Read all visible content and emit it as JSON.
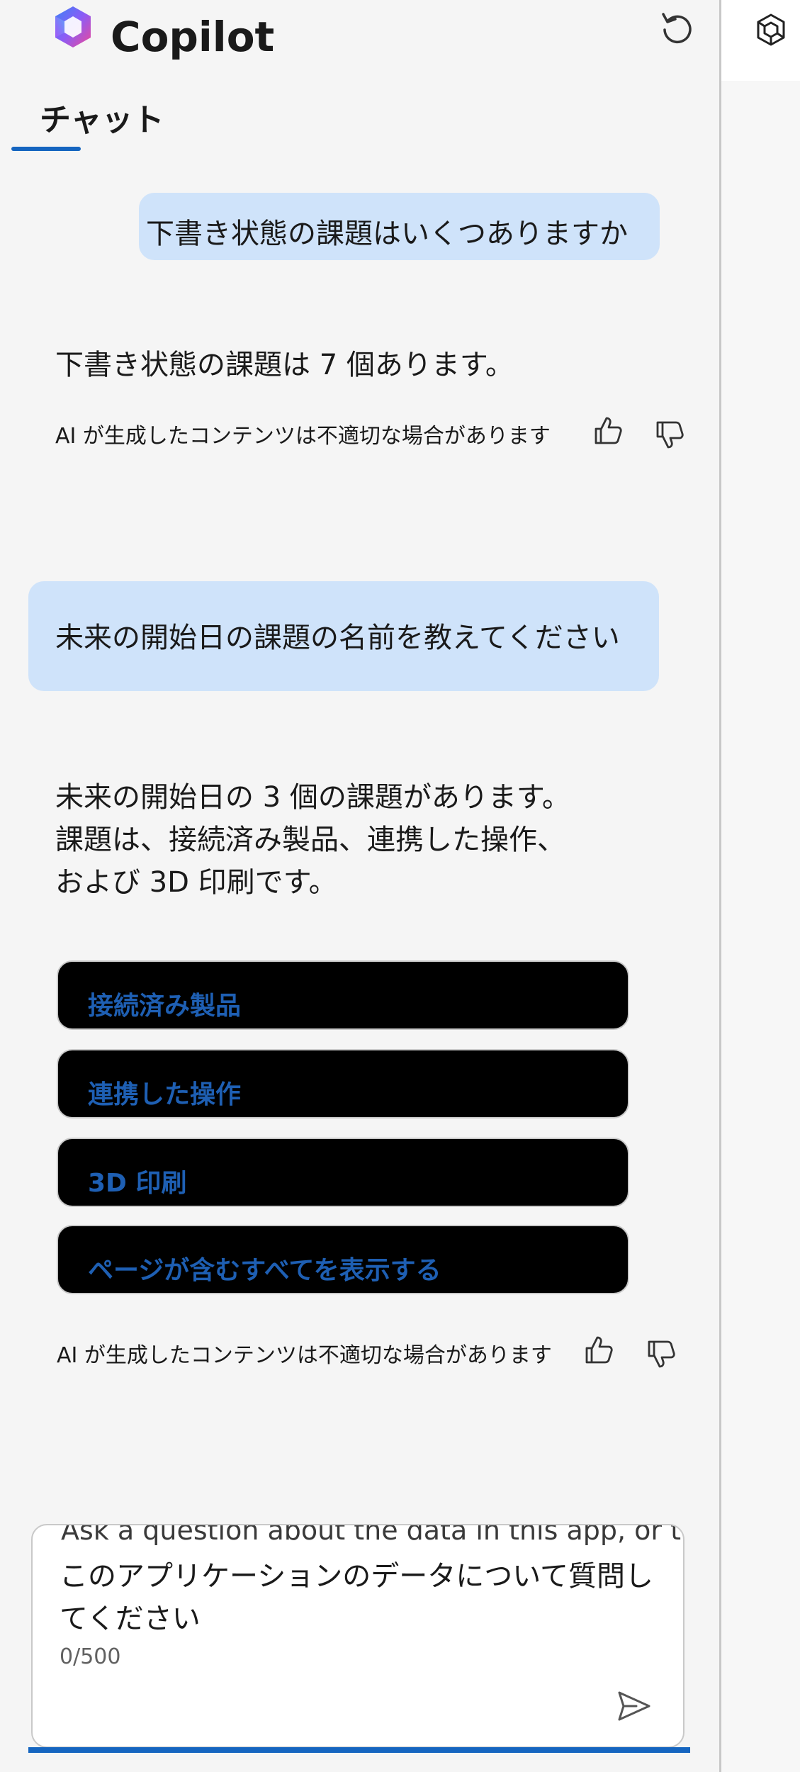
{
  "header": {
    "title": "Copilot",
    "logo_icon": "copilot-logo",
    "reset_icon": "refresh-icon"
  },
  "tabs": [
    {
      "label": "チャット",
      "active": true
    }
  ],
  "conversation": {
    "turn1": {
      "question": "下書き状態の課題はいくつありますか",
      "answer": "下書き状態の課題は 7 個あります。",
      "disclaimer": "AI が生成したコンテンツは不適切な場合があります"
    },
    "turn2": {
      "question": "未来の開始日の課題の名前を教えてください",
      "answer_lines": [
        "未来の開始日の 3 個の課題があります。",
        "課題は、接続済み製品、連携した操作、",
        "および 3D 印刷です。"
      ],
      "links": [
        "接続済み製品",
        "連携した操作",
        "3D 印刷",
        "ページが含むすべてを表示する"
      ],
      "disclaimer": "AI が生成したコンテンツは不適切な場合があります"
    }
  },
  "input": {
    "ghost_text": "Ask a question about the data in this app, or tell",
    "placeholder": "このアプリケーションのデータについて質問してください",
    "char_count": "0/500",
    "send_icon": "send-icon"
  },
  "rail": {
    "icon": "copilot-rail-icon"
  },
  "colors": {
    "accent": "#1565c0",
    "user_bubble": "#cfe3fa",
    "link_text": "#1e5fb3",
    "link_card_bg": "#000000",
    "panel_bg": "#f5f5f5"
  }
}
